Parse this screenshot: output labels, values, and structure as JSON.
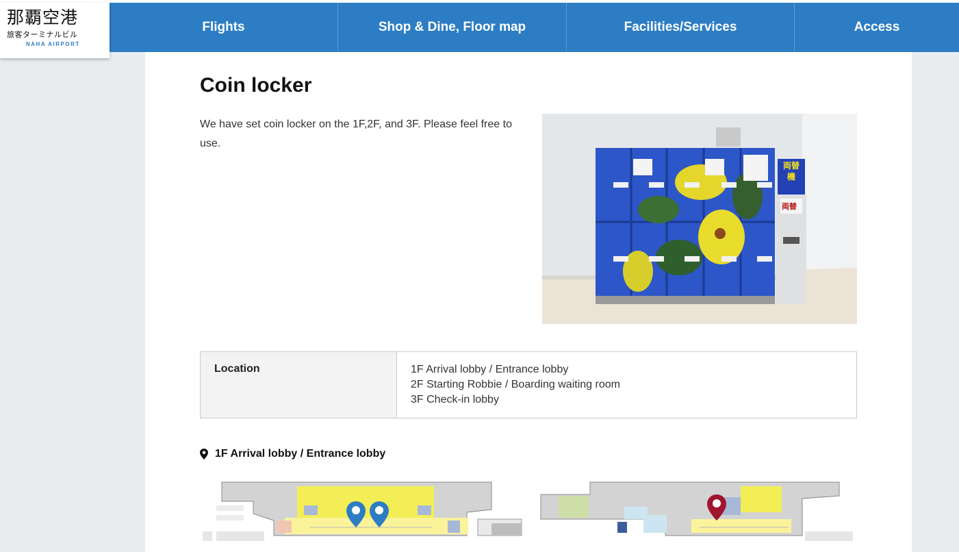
{
  "logo": {
    "jp": "那覇空港",
    "sub": "旅客ターミナルビル",
    "en": "NAHA AIRPORT"
  },
  "nav": {
    "items": [
      {
        "label": "Flights"
      },
      {
        "label": "Shop & Dine, Floor map"
      },
      {
        "label": "Facilities/Services"
      },
      {
        "label": "Access"
      }
    ]
  },
  "page": {
    "title": "Coin locker",
    "intro": "We have set coin locker on the 1F,2F, and 3F. Please feel free to use."
  },
  "photo": {
    "sign_text": "両替機",
    "machine_label": "両替"
  },
  "location_table": {
    "label": "Location",
    "values": [
      "1F Arrival lobby / Entrance lobby",
      "2F Starting Robbie / Boarding waiting room",
      "3F Check-in lobby"
    ]
  },
  "map_section": {
    "heading": "1F Arrival lobby / Entrance lobby",
    "pin_icon": "map-pin-icon"
  },
  "colors": {
    "nav_bg": "#2c7dc4",
    "pin_blue": "#2c7dc4",
    "pin_red": "#a0142e",
    "map_yellow": "#f4ef5a",
    "map_gray": "#d6d6d6"
  }
}
